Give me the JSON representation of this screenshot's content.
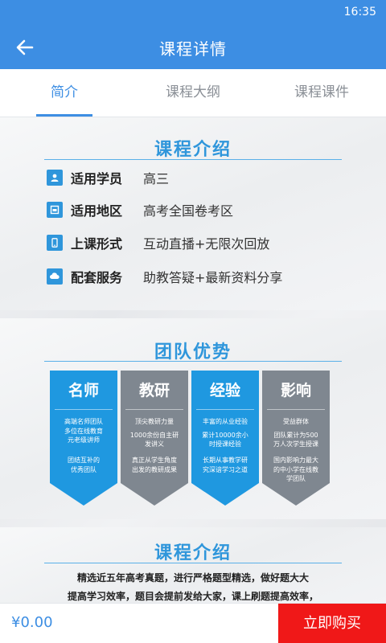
{
  "status_bar": {
    "time": "16:35"
  },
  "header": {
    "title": "课程详情",
    "back_icon": "arrow-left-icon"
  },
  "tabs": [
    {
      "label": "简介",
      "active": true
    },
    {
      "label": "课程大纲",
      "active": false
    },
    {
      "label": "课程课件",
      "active": false
    }
  ],
  "intro": {
    "title": "课程介绍",
    "rows": [
      {
        "icon": "person-icon",
        "label": "适用学员",
        "value": "高三"
      },
      {
        "icon": "location-icon",
        "label": "适用地区",
        "value": "高考全国卷考区"
      },
      {
        "icon": "phone-icon",
        "label": "上课形式",
        "value": "互动直播+无限次回放"
      },
      {
        "icon": "cloud-icon",
        "label": "配套服务",
        "value": "助教答疑+最新资料分享"
      }
    ]
  },
  "team": {
    "title": "团队优势",
    "cards": [
      {
        "name": "名师",
        "color": "#1f98e0",
        "lines": [
          "高端名师团队",
          "多位在线教育",
          "元老级讲师",
          "",
          "团结互补的",
          "优秀团队"
        ]
      },
      {
        "name": "教研",
        "color": "#7f8790",
        "lines": [
          "顶尖教研力量",
          "",
          "1000余份自主研",
          "发讲义",
          "",
          "真正从学生角度",
          "出发的教研成果"
        ]
      },
      {
        "name": "经验",
        "color": "#1f98e0",
        "lines": [
          "丰富的从业经验",
          "",
          "累计10000余小",
          "时授课经验",
          "",
          "长期从事教学研",
          "究深谙学习之道"
        ]
      },
      {
        "name": "影响",
        "color": "#7f8790",
        "lines": [
          "受益群体",
          "",
          "团队累计为500",
          "万人次学生授课",
          "",
          "国内影响力最大",
          "的中小学在线教",
          "学团队"
        ]
      }
    ]
  },
  "intro2": {
    "title": "课程介绍",
    "paragraph_lines": [
      "精选近五年高考真题，进行严格题型精选，做好题大大",
      "提高学习效率，题目会提前发给大家，课上刷题提高效率，"
    ]
  },
  "bottom": {
    "price": "¥0.00",
    "buy_label": "立即购买"
  },
  "colors": {
    "primary": "#3d8ee3",
    "buy": "#f01818",
    "team_blue": "#1f98e0",
    "team_gray": "#7f8790"
  }
}
